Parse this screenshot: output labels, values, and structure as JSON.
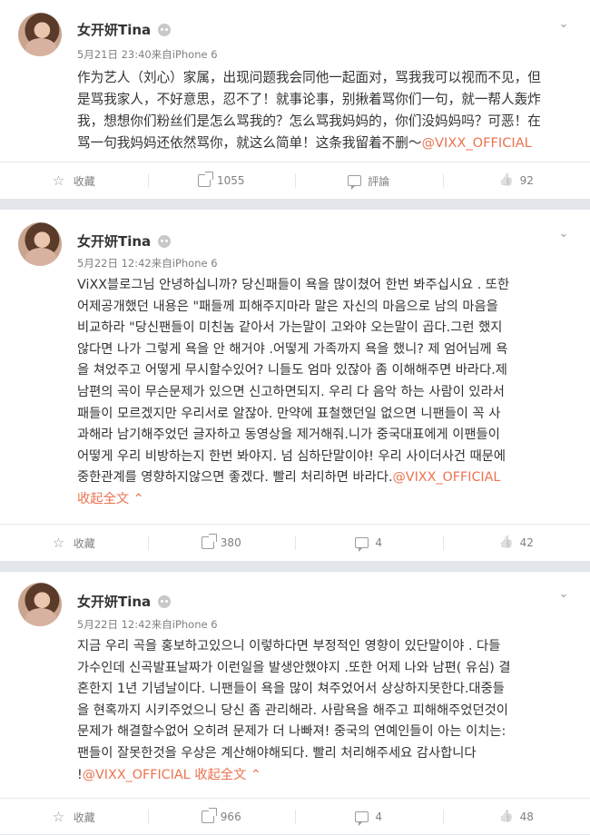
{
  "posts": [
    {
      "author": "女开妍Tina",
      "meta": "5月21日 23:40来自iPhone 6",
      "lines": [
        "作为艺人（刘心）家属，出现问题我会同他一起面对，骂我我可以视而不见，但",
        "是骂我家人，不好意思，忍不了！就事论事，别揪着骂你们一句，就一帮人轰炸",
        "我，想想你们粉丝们是怎么骂我的？怎么骂我妈妈的，你们没妈妈吗？可恶！在"
      ],
      "last_line": "骂一句我妈妈还依然骂你，就这么简单！这条我留着不删～",
      "mention": "@VIXX_OFFICIAL",
      "collapse": "",
      "actions": {
        "favorite": "收藏",
        "repost": "1055",
        "comment": "評論",
        "like": "92"
      }
    },
    {
      "author": "女开妍Tina",
      "meta": "5月22日 12:42来自iPhone 6",
      "lines": [
        "ViXX블로그님 안녕하십니까? 당신패들이 욕을 많이쳤어 한번 봐주십시요 . 또한",
        "어제공개했던 내용은 \"패들께 피해주지마라 말은  자신의 마음으로 남의 마음을",
        "비교하라 \"당신팬들이 미친놈 같아서 가는말이 고와야 오는말이 곱다.그런 했지",
        "않다면 나가 그렇게 욕을 안 해거야 .어떻게 가족까지 욕을 했니? 제 엄어님께 욕",
        "을 쳐었주고 어떻게 무시할수있어? 니들도 엄마 있잖아 좀 이해해주면 바라다.제",
        "남편의 곡이 무슨문제가 있으면 신고하면되지. 우리 다 음악 하는 사람이 있라서",
        "패들이 모르겠지만 우리서로 알잖아. 만약에 표철했던일 없으면 니팬들이 꼭 사",
        "과해라 남기해주었던 글자하고 동영상을 제거해줘.니가 중국대표에게 이팬들이",
        "어떻게 우리 비방하는지 한번 봐야지. 넘 심하단말이야! 우리 사이더사건 때문에"
      ],
      "last_line": "중한관계를 영향하지않으면 좋겠다. 빨리 처리하면 바라다.",
      "mention": "@VIXX_OFFICIAL",
      "collapse": "收起全文 ⌃",
      "actions": {
        "favorite": "收藏",
        "repost": "380",
        "comment": "4",
        "like": "42"
      }
    },
    {
      "author": "女开妍Tina",
      "meta": "5月22日 12:42来自iPhone 6",
      "lines": [
        "지금 우리 곡을 홍보하고있으니 이렇하다면 부정적인 영향이 있단말이야 . 다들",
        "가수인데 신곡발표날짜가 이런일을 발생안했야지 .또한 어제 나와 남편( 유심) 결",
        "혼한지 1년 기념날이다. 니팬들이 욕을 많이 쳐주었어서 상상하지못한다.대중들",
        "을 현혹까지 시키주었으니 당신 좀 관리해라. 사람욕을 해주고 피해해주었던것이",
        "문제가 해결할수없어 오히려 문제가 더 나빠져! 중국의 연예인들이 아는 이치는:",
        "팬들이 잘못한것을 우상은 계산해야해되다. 빨리 처리해주세요 감사합니다"
      ],
      "last_line": "!",
      "mention": "@VIXX_OFFICIAL",
      "collapse": "收起全文 ⌃",
      "actions": {
        "favorite": "收藏",
        "repost": "966",
        "comment": "4",
        "like": "48"
      }
    }
  ]
}
